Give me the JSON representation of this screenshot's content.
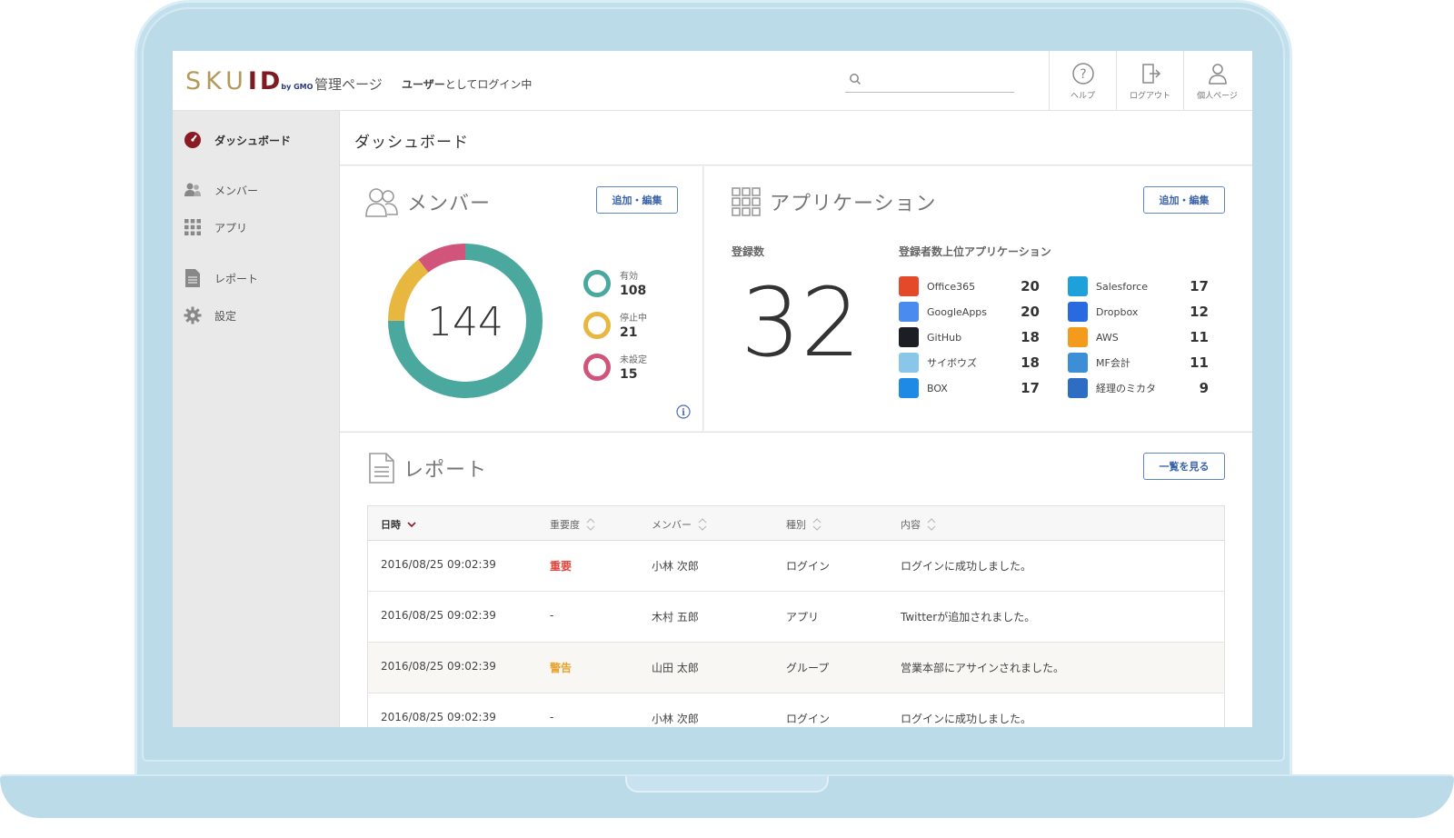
{
  "header": {
    "logo_sku": "SKU",
    "logo_id": "ID",
    "logo_by": "by GMO",
    "admin_label": "管理ページ",
    "login_user": "ユーザー",
    "login_suffix": "としてログイン中",
    "search_placeholder": "",
    "help_label": "ヘルプ",
    "logout_label": "ログアウト",
    "profile_label": "個人ページ"
  },
  "sidebar": {
    "items": [
      {
        "label": "ダッシュボード",
        "icon": "dashboard-icon",
        "active": true
      },
      {
        "label": "メンバー",
        "icon": "members-icon"
      },
      {
        "label": "アプリ",
        "icon": "apps-grid-icon"
      },
      {
        "label": "レポート",
        "icon": "report-icon"
      },
      {
        "label": "設定",
        "icon": "gear-icon"
      }
    ]
  },
  "page_title": "ダッシュボード",
  "members": {
    "title": "メンバー",
    "edit_button": "追加・編集",
    "total": "144",
    "legend": [
      {
        "label": "有効",
        "value": "108",
        "color": "#4aa89e"
      },
      {
        "label": "停止中",
        "value": "21",
        "color": "#e8b740"
      },
      {
        "label": "未設定",
        "value": "15",
        "color": "#d1557a"
      }
    ]
  },
  "applications": {
    "title": "アプリケーション",
    "edit_button": "追加・編集",
    "registered_label": "登録数",
    "registered_count": "32",
    "top_label": "登録者数上位アプリケーション",
    "left": [
      {
        "name": "Office365",
        "value": "20",
        "color": "#e4492a"
      },
      {
        "name": "GoogleApps",
        "value": "20",
        "color": "#4a8bf0"
      },
      {
        "name": "GitHub",
        "value": "18",
        "color": "#1b1f23"
      },
      {
        "name": "サイボウズ",
        "value": "18",
        "color": "#8ac6e9"
      },
      {
        "name": "BOX",
        "value": "17",
        "color": "#1f8ae6"
      }
    ],
    "right": [
      {
        "name": "Salesforce",
        "value": "17",
        "color": "#1ea0db"
      },
      {
        "name": "Dropbox",
        "value": "12",
        "color": "#2a6ae0"
      },
      {
        "name": "AWS",
        "value": "11",
        "color": "#f29b1d"
      },
      {
        "name": "MF会計",
        "value": "11",
        "color": "#3c8ed6"
      },
      {
        "name": "経理のミカタ",
        "value": "9",
        "color": "#2d6ec4"
      }
    ]
  },
  "report": {
    "title": "レポート",
    "view_all_button": "一覧を見る",
    "columns": [
      "日時",
      "重要度",
      "メンバー",
      "種別",
      "内容"
    ],
    "rows": [
      {
        "datetime": "2016/08/25 09:02:39",
        "severity": "重要",
        "member": "小林 次郎",
        "type": "ログイン",
        "content": "ログインに成功しました。"
      },
      {
        "datetime": "2016/08/25 09:02:39",
        "severity": "-",
        "member": "木村 五郎",
        "type": "アプリ",
        "content": "Twitterが追加されました。"
      },
      {
        "datetime": "2016/08/25 09:02:39",
        "severity": "警告",
        "member": "山田 太郎",
        "type": "グループ",
        "content": "営業本部にアサインされました。"
      },
      {
        "datetime": "2016/08/25 09:02:39",
        "severity": "-",
        "member": "小林 次郎",
        "type": "ログイン",
        "content": "ログインに成功しました。"
      }
    ]
  }
}
